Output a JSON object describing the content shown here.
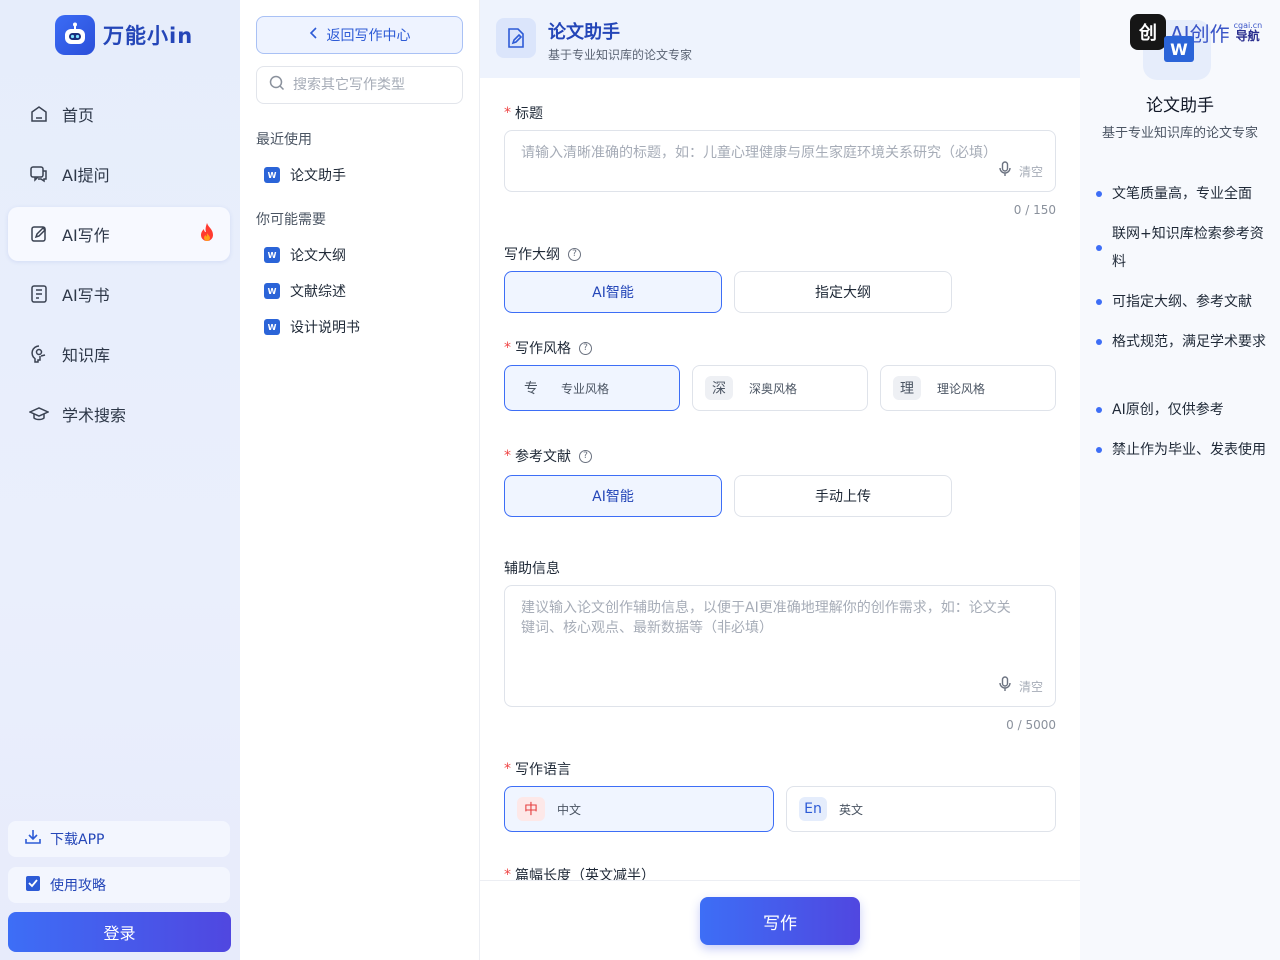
{
  "brand": {
    "name": "万能小in"
  },
  "nav": {
    "items": [
      {
        "label": "首页",
        "icon": "home-icon"
      },
      {
        "label": "AI提问",
        "icon": "chat-icon"
      },
      {
        "label": "AI写作",
        "icon": "write-icon",
        "active": true,
        "hot": true
      },
      {
        "label": "AI写书",
        "icon": "book-icon"
      },
      {
        "label": "知识库",
        "icon": "knowledge-icon"
      },
      {
        "label": "学术搜索",
        "icon": "graduation-cap-icon"
      }
    ],
    "download": "下载APP",
    "guide": "使用攻略",
    "login": "登录"
  },
  "catalog": {
    "back": "返回写作中心",
    "search_placeholder": "搜索其它写作类型",
    "recent_title": "最近使用",
    "recent": [
      "论文助手"
    ],
    "suggest_title": "你可能需要",
    "suggest": [
      "论文大纲",
      "文献综述",
      "设计说明书"
    ]
  },
  "form": {
    "title": "论文助手",
    "subtitle": "基于专业知识库的论文专家",
    "field_title": {
      "label": "标题",
      "placeholder": "请输入清晰准确的标题，如：儿童心理健康与原生家庭环境关系研究（必填）",
      "clear": "清空",
      "counter": "0 / 150"
    },
    "outline": {
      "label": "写作大纲",
      "options": [
        "AI智能",
        "指定大纲"
      ],
      "selected": 0
    },
    "style": {
      "label": "写作风格",
      "options": [
        {
          "badge": "专",
          "label": "专业风格"
        },
        {
          "badge": "深",
          "label": "深奥风格"
        },
        {
          "badge": "理",
          "label": "理论风格"
        }
      ],
      "selected": 0
    },
    "references": {
      "label": "参考文献",
      "options": [
        "AI智能",
        "手动上传"
      ],
      "selected": 0
    },
    "aux": {
      "label": "辅助信息",
      "placeholder": "建议输入论文创作辅助信息，以便于AI更准确地理解你的创作需求，如：论文关键词、核心观点、最新数据等（非必填）",
      "clear": "清空",
      "counter": "0 / 5000"
    },
    "language": {
      "label": "写作语言",
      "options": [
        {
          "badge": "中",
          "label": "中文"
        },
        {
          "badge": "En",
          "label": "英文"
        }
      ],
      "selected": 0
    },
    "length": {
      "label": "篇幅长度（英文减半）"
    },
    "submit": "写作"
  },
  "info": {
    "watermark": "AI创作",
    "watermark_sub": "导航",
    "watermark_url": "cgai.cn",
    "title": "论文助手",
    "subtitle": "基于专业知识库的论文专家",
    "features": [
      "文笔质量高，专业全面",
      "联网+知识库检索参考资料",
      "可指定大纲、参考文献",
      "格式规范，满足学术要求",
      "AI原创，仅供参考",
      "禁止作为毕业、发表使用"
    ]
  },
  "colors": {
    "accent": "#3d6ef6",
    "brand": "#2446b8",
    "required": "#ef4444"
  }
}
